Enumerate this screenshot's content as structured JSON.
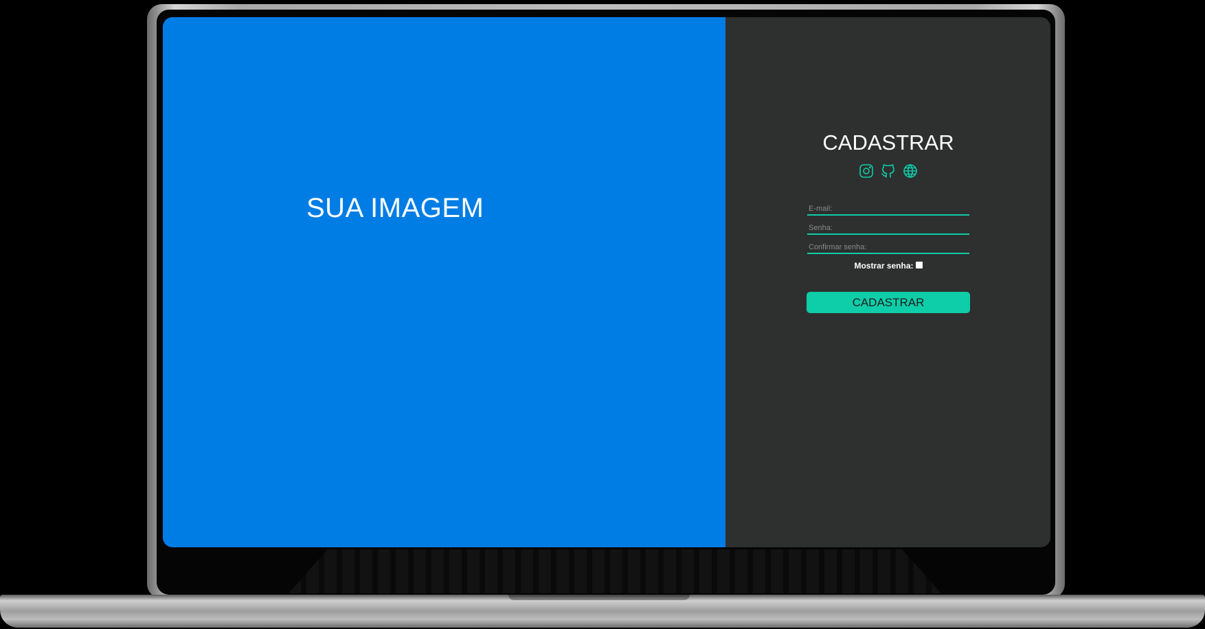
{
  "image_panel": {
    "text": "SUA IMAGEM",
    "background": "#007de5"
  },
  "form": {
    "title": "CADASTRAR",
    "social_icons": [
      "instagram-icon",
      "github-icon",
      "globe-icon"
    ],
    "fields": {
      "email_placeholder": "E-mail:",
      "password_placeholder": "Senha:",
      "confirm_placeholder": "Confirmar senha:"
    },
    "show_password_label": "Mostrar senha:",
    "submit_label": "CADASTRAR",
    "accent": "#0ecda9",
    "background": "#2e2f2f"
  }
}
